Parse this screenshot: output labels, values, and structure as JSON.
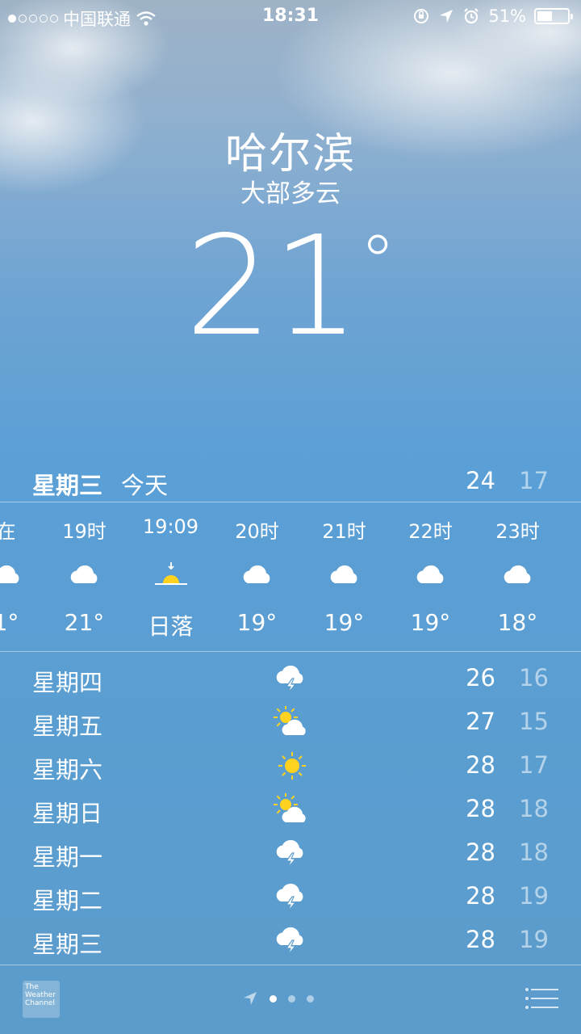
{
  "status_bar": {
    "carrier": "中国联通",
    "time": "18:31",
    "battery": "51%",
    "battery_level": 0.51,
    "signal_dots_filled": 1
  },
  "location": {
    "city": "哈尔滨",
    "condition": "大部多云",
    "temperature": "21",
    "degree": "°"
  },
  "today": {
    "day": "星期三",
    "label": "今天",
    "high": "24",
    "low": "17"
  },
  "hourly": [
    {
      "time": "在",
      "icon": "cloud-icon",
      "temp": "1°"
    },
    {
      "time": "19时",
      "icon": "cloud-icon",
      "temp": "21°"
    },
    {
      "time": "19:09",
      "icon": "sunset-icon",
      "temp": "日落"
    },
    {
      "time": "20时",
      "icon": "cloud-icon",
      "temp": "19°"
    },
    {
      "time": "21时",
      "icon": "cloud-icon",
      "temp": "19°"
    },
    {
      "time": "22时",
      "icon": "cloud-icon",
      "temp": "19°"
    },
    {
      "time": "23时",
      "icon": "cloud-icon",
      "temp": "18°"
    }
  ],
  "daily": [
    {
      "day": "星期四",
      "icon": "thunderstorm-icon",
      "high": "26",
      "low": "16"
    },
    {
      "day": "星期五",
      "icon": "partly-sunny-icon",
      "high": "27",
      "low": "15"
    },
    {
      "day": "星期六",
      "icon": "sun-icon",
      "high": "28",
      "low": "17"
    },
    {
      "day": "星期日",
      "icon": "partly-sunny-icon",
      "high": "28",
      "low": "18"
    },
    {
      "day": "星期一",
      "icon": "thunderstorm-icon",
      "high": "28",
      "low": "18"
    },
    {
      "day": "星期二",
      "icon": "thunderstorm-icon",
      "high": "28",
      "low": "19"
    },
    {
      "day": "星期三",
      "icon": "thunderstorm-icon",
      "high": "28",
      "low": "19"
    }
  ],
  "footer": {
    "logo_text": "The Weather Channel",
    "pages": 3,
    "active_page": 0
  }
}
